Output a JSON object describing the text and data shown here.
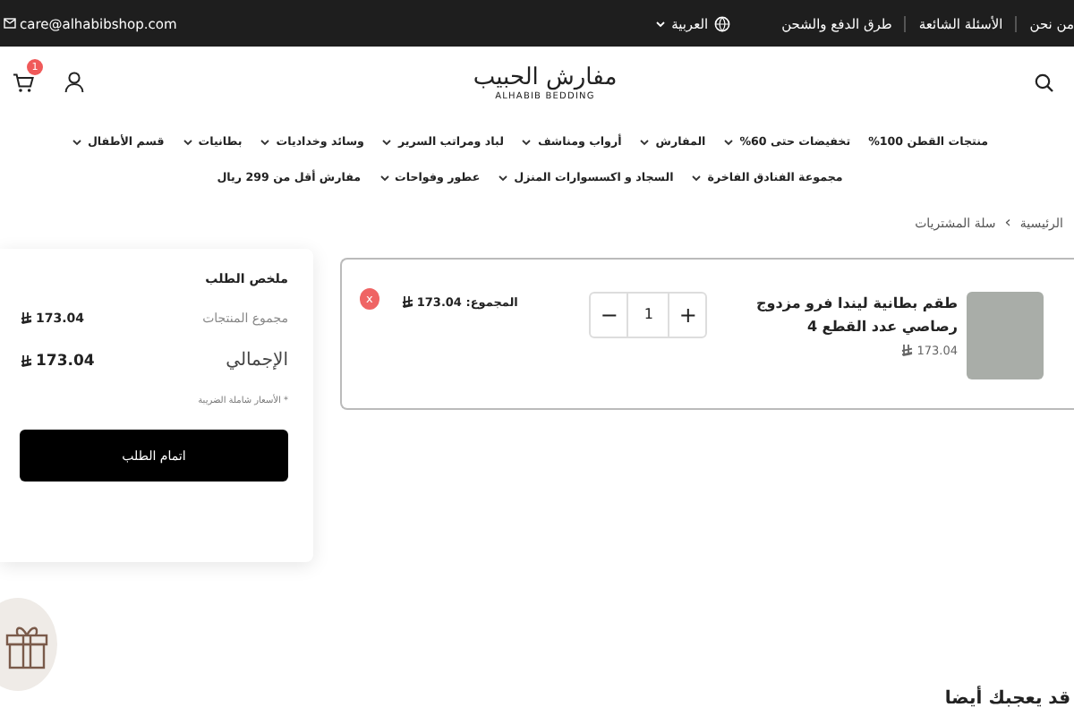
{
  "top_bar": {
    "links": [
      "من نحن",
      "الأسئلة الشائعة",
      "طرق الدفع والشحن"
    ],
    "language": "العربية",
    "email": "care@alhabibshop.com"
  },
  "header": {
    "logo_arabic": "مفارش الحبيب",
    "logo_latin": "ALHABIB BEDDING",
    "cart_count": "1"
  },
  "nav": [
    {
      "label": "منتجات القطن 100%",
      "has_dropdown": false
    },
    {
      "label": "تخفيضات حتى 60%",
      "has_dropdown": true
    },
    {
      "label": "المفارش",
      "has_dropdown": true
    },
    {
      "label": "أرواب ومناشف",
      "has_dropdown": true
    },
    {
      "label": "لباد ومراتب السرير",
      "has_dropdown": true
    },
    {
      "label": "وسائد وخداديات",
      "has_dropdown": true
    },
    {
      "label": "بطانيات",
      "has_dropdown": true
    },
    {
      "label": "قسم الأطفال",
      "has_dropdown": true
    },
    {
      "label": "مجموعة الفنادق الفاخرة",
      "has_dropdown": true
    },
    {
      "label": "السجاد و اكسسوارات المنزل",
      "has_dropdown": true
    },
    {
      "label": "عطور وفواحات",
      "has_dropdown": true
    },
    {
      "label": "مفارش أقل من 299 ريال",
      "has_dropdown": false
    }
  ],
  "breadcrumb": {
    "items": [
      "الرئيسية",
      "سلة المشتريات"
    ],
    "separator": "›"
  },
  "cart_items": [
    {
      "title": "طقم بطانية ليندا فرو مزدوج رصاصي عدد القطع 4",
      "price": "173.04",
      "quantity": "1",
      "minus": "−",
      "plus": "+",
      "total_label": "المجموع:",
      "total": "173.04",
      "remove": "x"
    }
  ],
  "summary": {
    "title": "ملخص الطلب",
    "subtotal_label": "مجموع المنتجات",
    "subtotal": "173.04",
    "total_label": "الإجمالي",
    "total": "173.04",
    "tax_note": "* الأسعار شاملة الضريبة",
    "checkout": "اتمام الطلب"
  },
  "recommendations": {
    "title": "قد يعجبك أيضا"
  }
}
